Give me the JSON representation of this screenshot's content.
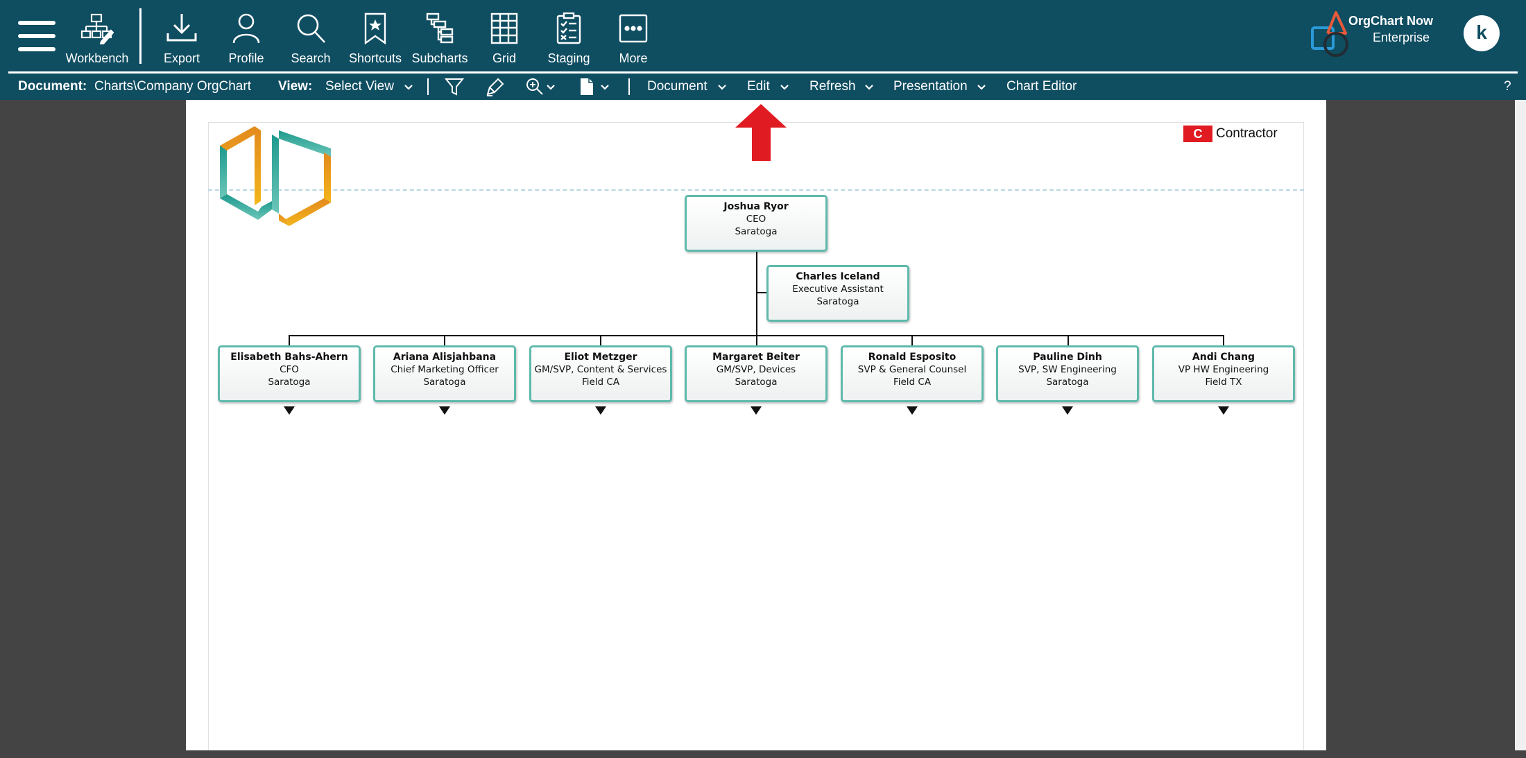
{
  "toolbar": {
    "items": [
      {
        "label": "Workbench",
        "icon": "workbench-icon"
      },
      {
        "label": "Export",
        "icon": "export-icon"
      },
      {
        "label": "Profile",
        "icon": "profile-icon"
      },
      {
        "label": "Search",
        "icon": "search-icon"
      },
      {
        "label": "Shortcuts",
        "icon": "shortcuts-icon"
      },
      {
        "label": "Subcharts",
        "icon": "subcharts-icon"
      },
      {
        "label": "Grid",
        "icon": "grid-icon"
      },
      {
        "label": "Staging",
        "icon": "staging-icon"
      },
      {
        "label": "More",
        "icon": "more-icon"
      }
    ],
    "brand_name": "OrgChart Now",
    "brand_edition": "Enterprise",
    "avatar_initial": "k"
  },
  "subbar": {
    "document_label": "Document:",
    "document_path": "Charts\\Company OrgChart",
    "view_label": "View:",
    "view_value": "Select View",
    "menus": [
      "Document",
      "Edit",
      "Refresh",
      "Presentation",
      "Chart Editor"
    ],
    "help": "?"
  },
  "legend": {
    "chip": "C",
    "label": "Contractor"
  },
  "chart": {
    "root": {
      "name": "Joshua Ryor",
      "title": "CEO",
      "location": "Saratoga"
    },
    "assistant": {
      "name": "Charles Iceland",
      "title": "Executive Assistant",
      "location": "Saratoga"
    },
    "reports": [
      {
        "name": "Elisabeth Bahs-Ahern",
        "title": "CFO",
        "location": "Saratoga"
      },
      {
        "name": "Ariana Alisjahbana",
        "title": "Chief Marketing Officer",
        "location": "Saratoga"
      },
      {
        "name": "Eliot Metzger",
        "title": "GM/SVP, Content & Services",
        "location": "Field CA"
      },
      {
        "name": "Margaret Beiter",
        "title": "GM/SVP, Devices",
        "location": "Saratoga"
      },
      {
        "name": "Ronald Esposito",
        "title": "SVP & General Counsel",
        "location": "Field CA"
      },
      {
        "name": "Pauline Dinh",
        "title": "SVP, SW Engineering",
        "location": "Saratoga"
      },
      {
        "name": "Andi Chang",
        "title": "VP HW Engineering",
        "location": "Field TX"
      }
    ]
  },
  "colors": {
    "toolbar_bg": "#0f4d61",
    "card_border": "#5fb9ac",
    "contractor": "#e11b22",
    "arrow": "#e11b22"
  }
}
